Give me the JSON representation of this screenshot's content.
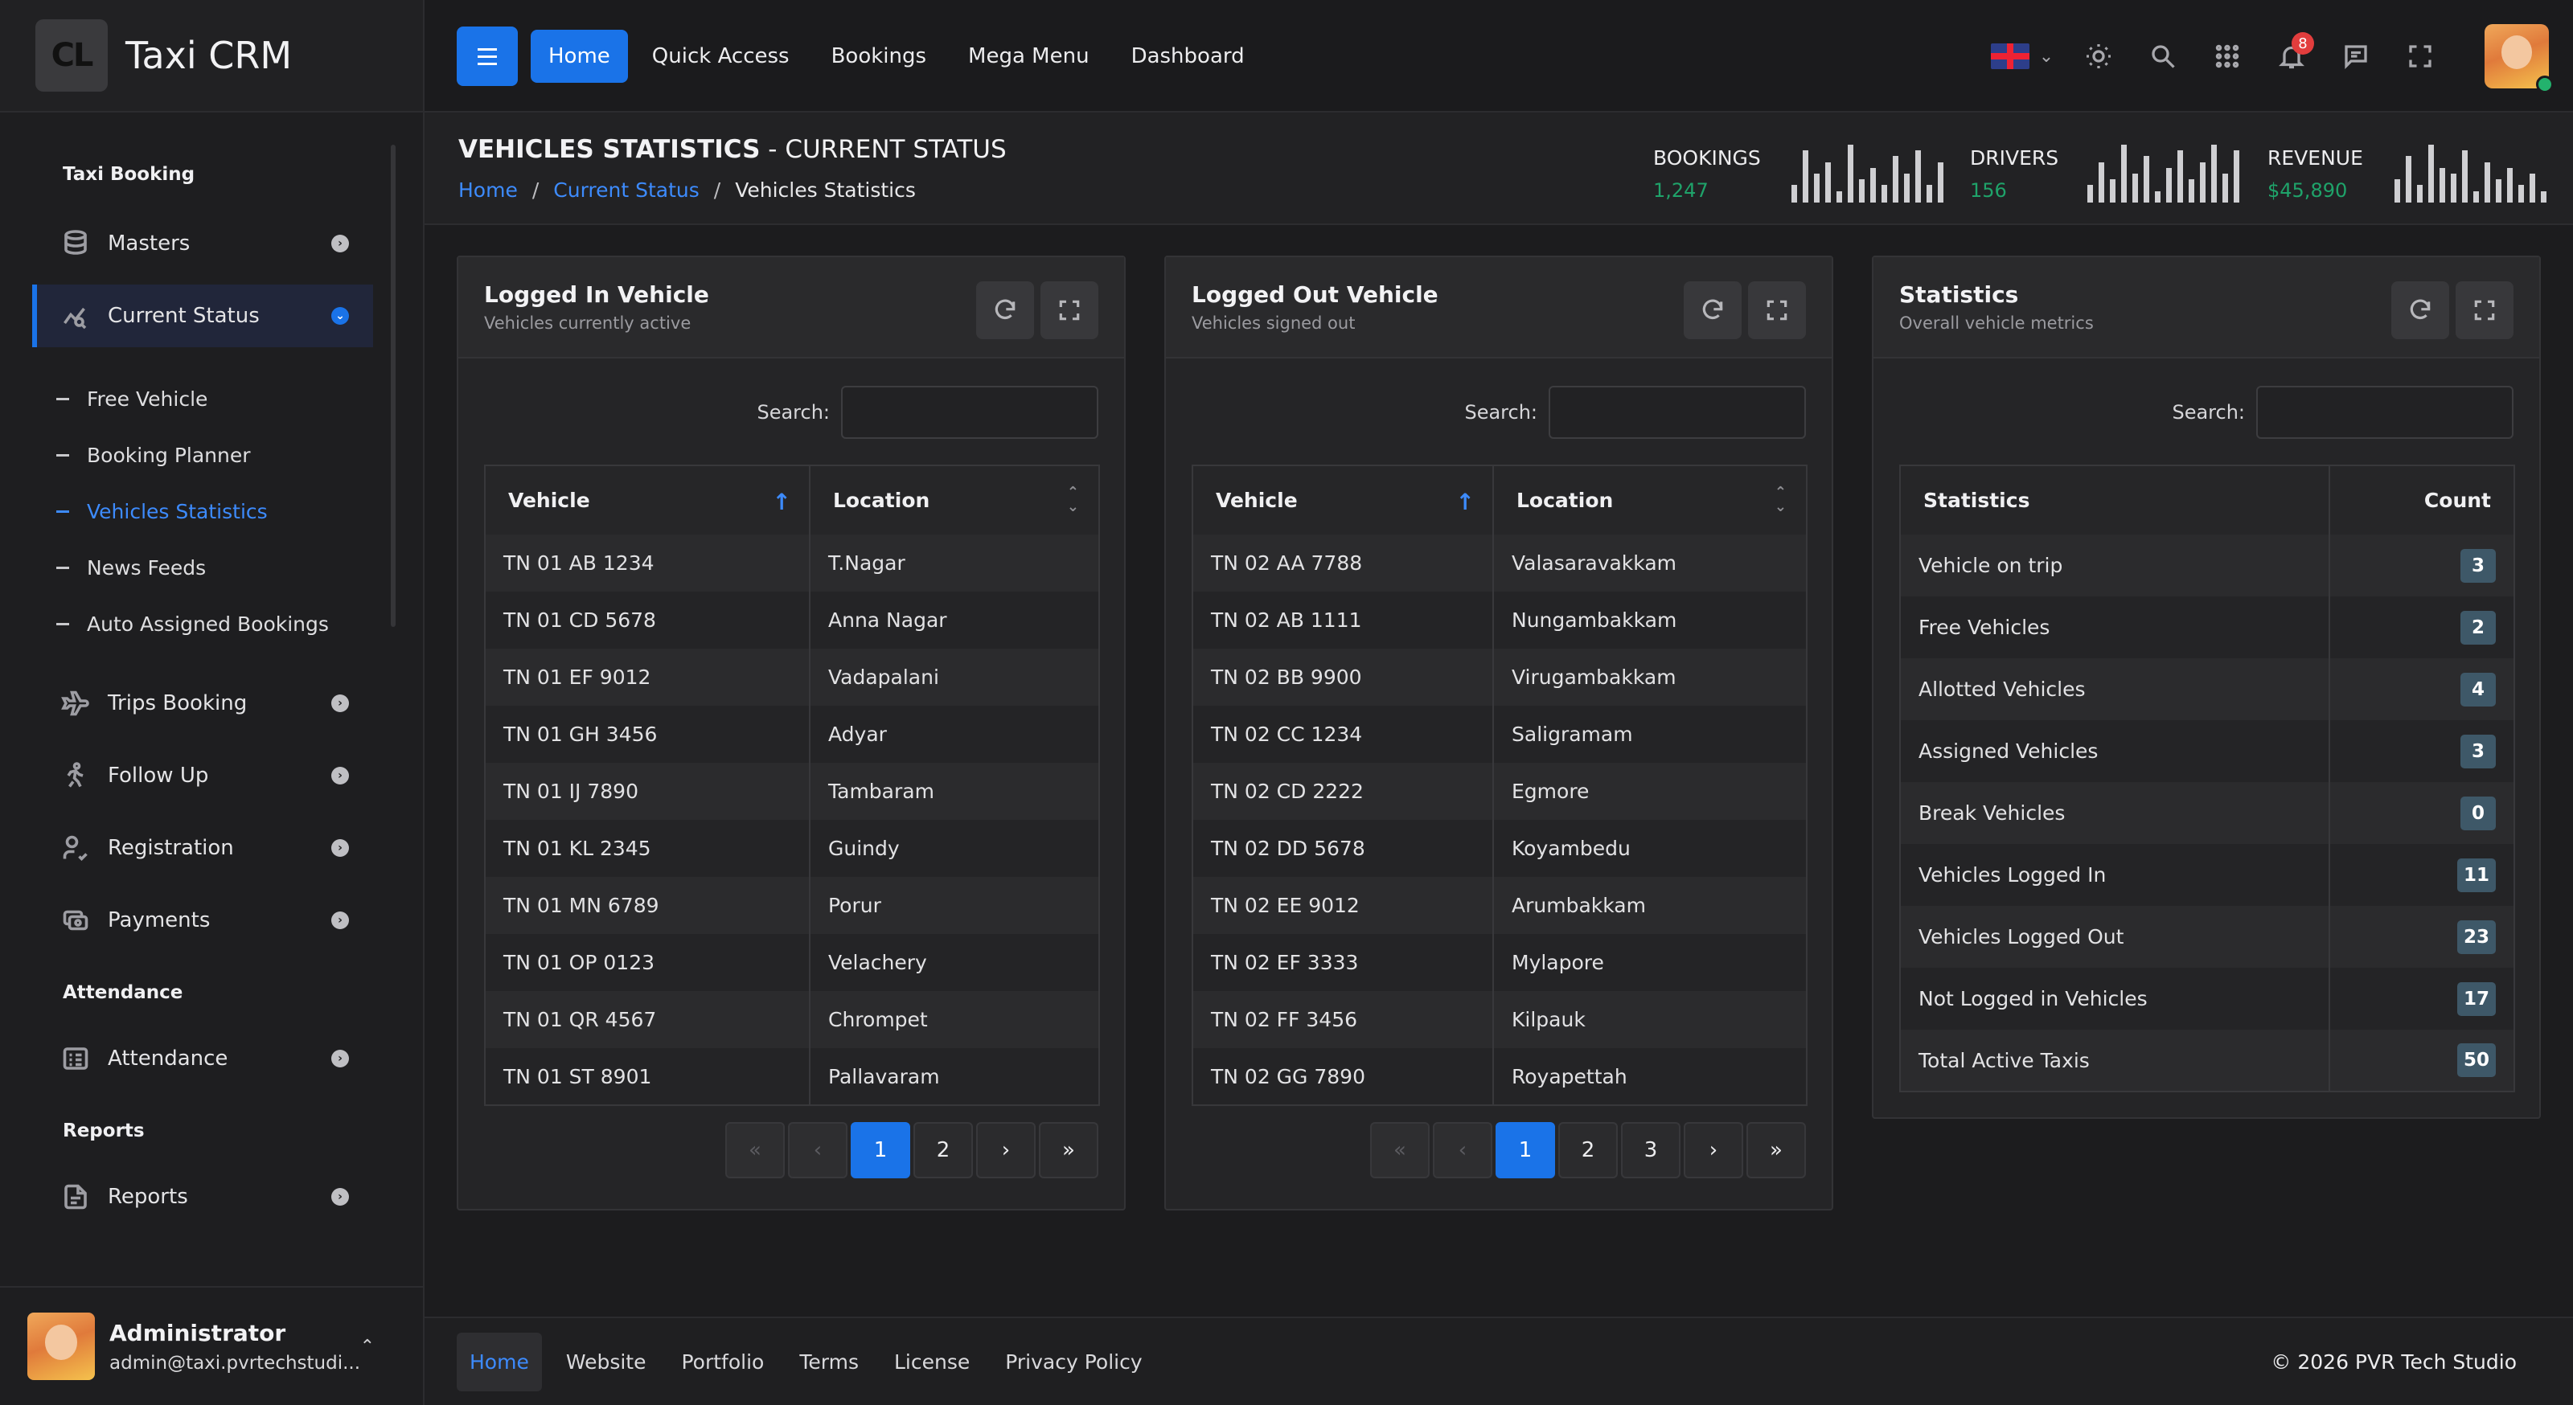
{
  "brand": {
    "logo_text": "CL",
    "name": "Taxi CRM"
  },
  "sidebar": {
    "sections": {
      "taxi": "Taxi Booking",
      "attendance": "Attendance",
      "reports": "Reports"
    },
    "items": [
      {
        "label": "Masters",
        "icon": "database-icon"
      },
      {
        "label": "Current Status",
        "icon": "chart-search-icon"
      },
      {
        "label": "Trips Booking",
        "icon": "plane-icon"
      },
      {
        "label": "Follow Up",
        "icon": "walk-icon"
      },
      {
        "label": "Registration",
        "icon": "user-check-icon"
      },
      {
        "label": "Payments",
        "icon": "cash-icon"
      },
      {
        "label": "Attendance",
        "icon": "list-details-icon"
      },
      {
        "label": "Reports",
        "icon": "file-report-icon"
      }
    ],
    "subitems": [
      "Free Vehicle",
      "Booking Planner",
      "Vehicles Statistics",
      "News Feeds",
      "Auto Assigned Bookings"
    ]
  },
  "user": {
    "name": "Administrator",
    "email": "admin@taxi.pvrtechstudi..."
  },
  "topnav": [
    "Home",
    "Quick Access",
    "Bookings",
    "Mega Menu",
    "Dashboard"
  ],
  "notifications": {
    "count": "8"
  },
  "header": {
    "title_bold": "VEHICLES STATISTICS",
    "title_rest": " - CURRENT STATUS",
    "breadcrumb": [
      "Home",
      "Current Status",
      "Vehicles Statistics"
    ],
    "breadcrumb_sep": "/",
    "stats": [
      {
        "label": "BOOKINGS",
        "value": "1,247",
        "bars": [
          0.3,
          0.9,
          0.5,
          0.7,
          0.2,
          1.0,
          0.4,
          0.6,
          0.3,
          0.8,
          0.5,
          0.9,
          0.3,
          0.7
        ]
      },
      {
        "label": "DRIVERS",
        "value": "156",
        "bars": [
          0.3,
          0.7,
          0.4,
          1.0,
          0.5,
          0.8,
          0.2,
          0.6,
          0.9,
          0.4,
          0.7,
          1.0,
          0.5,
          0.9
        ]
      },
      {
        "label": "REVENUE",
        "value": "$45,890",
        "bars": [
          0.4,
          0.8,
          0.3,
          1.0,
          0.6,
          0.5,
          0.9,
          0.2,
          0.7,
          0.4,
          0.6,
          0.3,
          0.5,
          0.2
        ]
      }
    ]
  },
  "search_label": "Search:",
  "logged_in": {
    "title": "Logged In Vehicle",
    "subtitle": "Vehicles currently active",
    "columns": [
      "Vehicle",
      "Location"
    ],
    "rows": [
      [
        "TN 01 AB 1234",
        "T.Nagar"
      ],
      [
        "TN 01 CD 5678",
        "Anna Nagar"
      ],
      [
        "TN 01 EF 9012",
        "Vadapalani"
      ],
      [
        "TN 01 GH 3456",
        "Adyar"
      ],
      [
        "TN 01 IJ 7890",
        "Tambaram"
      ],
      [
        "TN 01 KL 2345",
        "Guindy"
      ],
      [
        "TN 01 MN 6789",
        "Porur"
      ],
      [
        "TN 01 OP 0123",
        "Velachery"
      ],
      [
        "TN 01 QR 4567",
        "Chrompet"
      ],
      [
        "TN 01 ST 8901",
        "Pallavaram"
      ]
    ],
    "pages": [
      "1",
      "2"
    ]
  },
  "logged_out": {
    "title": "Logged Out Vehicle",
    "subtitle": "Vehicles signed out",
    "columns": [
      "Vehicle",
      "Location"
    ],
    "rows": [
      [
        "TN 02 AA 7788",
        "Valasaravakkam"
      ],
      [
        "TN 02 AB 1111",
        "Nungambakkam"
      ],
      [
        "TN 02 BB 9900",
        "Virugambakkam"
      ],
      [
        "TN 02 CC 1234",
        "Saligramam"
      ],
      [
        "TN 02 CD 2222",
        "Egmore"
      ],
      [
        "TN 02 DD 5678",
        "Koyambedu"
      ],
      [
        "TN 02 EE 9012",
        "Arumbakkam"
      ],
      [
        "TN 02 EF 3333",
        "Mylapore"
      ],
      [
        "TN 02 FF 3456",
        "Kilpauk"
      ],
      [
        "TN 02 GG 7890",
        "Royapettah"
      ]
    ],
    "pages": [
      "1",
      "2",
      "3"
    ]
  },
  "statistics": {
    "title": "Statistics",
    "subtitle": "Overall vehicle metrics",
    "columns": [
      "Statistics",
      "Count"
    ],
    "rows": [
      [
        "Vehicle on trip",
        "3"
      ],
      [
        "Free Vehicles",
        "2"
      ],
      [
        "Allotted Vehicles",
        "4"
      ],
      [
        "Assigned Vehicles",
        "3"
      ],
      [
        "Break Vehicles",
        "0"
      ],
      [
        "Vehicles Logged In",
        "11"
      ],
      [
        "Vehicles Logged Out",
        "23"
      ],
      [
        "Not Logged in Vehicles",
        "17"
      ],
      [
        "Total Active Taxis",
        "50"
      ]
    ]
  },
  "pager_symbols": {
    "first": "«",
    "prev": "‹",
    "next": "›",
    "last": "»"
  },
  "footer": {
    "links": [
      "Home",
      "Website",
      "Portfolio",
      "Terms",
      "License",
      "Privacy Policy"
    ],
    "copyright": "© 2026  PVR Tech Studio"
  },
  "colors": {
    "accent": "#1a73e8",
    "link": "#3d8bfd",
    "positive": "#1fa36a",
    "badge": "#e23d3d",
    "count_bg": "#3e5868"
  }
}
